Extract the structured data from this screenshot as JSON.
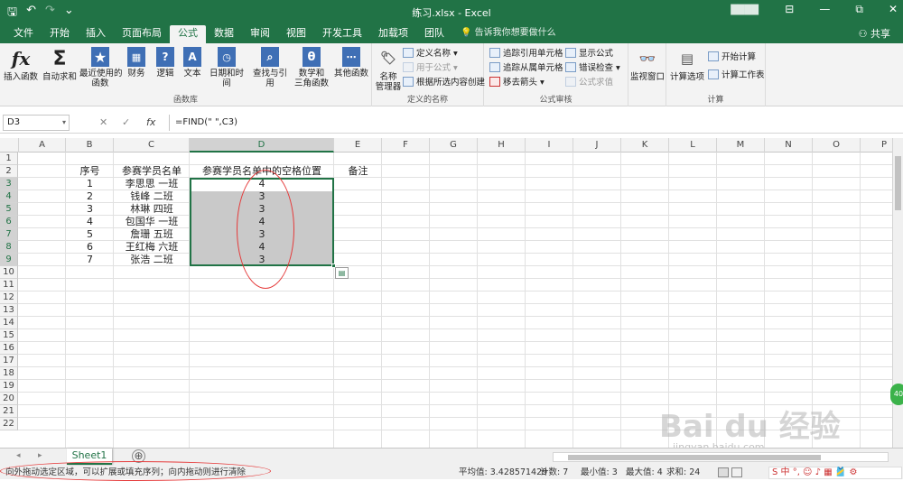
{
  "window": {
    "title": "练习.xlsx  -  Excel",
    "user": "████",
    "min": "—",
    "restore": "⧉",
    "close": "✕",
    "ribbon_opts": "⊟"
  },
  "qat": {
    "save": "🖫",
    "undo": "↶",
    "redo": "↷",
    "custom": "⌄"
  },
  "tabs": [
    "文件",
    "开始",
    "插入",
    "页面布局",
    "公式",
    "数据",
    "审阅",
    "视图",
    "开发工具",
    "加载项",
    "团队"
  ],
  "tell_me": "告诉我你想要做什么",
  "share": "共享",
  "ribbon": {
    "groups": {
      "library": "函数库",
      "names": "定义的名称",
      "audit": "公式审核",
      "calc": "计算"
    },
    "insert_function": "插入函数",
    "autosum": "自动求和",
    "recent": "最近使用的\n函数",
    "financial": "财务",
    "logical": "逻辑",
    "text": "文本",
    "datetime": "日期和时间",
    "lookup": "查找与引用",
    "math": "数学和\n三角函数",
    "other": "其他函数",
    "name_manager": "名称\n管理器",
    "define_name": "定义名称",
    "use_in_formula": "用于公式",
    "create_from_selection": "根据所选内容创建",
    "trace_precedents": "追踪引用单元格",
    "trace_dependents": "追踪从属单元格",
    "remove_arrows": "移去箭头",
    "show_formulas": "显示公式",
    "error_checking": "错误检查",
    "evaluate": "公式求值",
    "watch": "监视窗口",
    "calc_options": "计算选项",
    "calc_now": "开始计算",
    "calc_sheet": "计算工作表"
  },
  "formula_bar": {
    "name_box": "D3",
    "fx": "fx",
    "cancel": "✕",
    "enter": "✓",
    "formula": "=FIND(\" \",C3)"
  },
  "columns": [
    "A",
    "B",
    "C",
    "D",
    "E",
    "F",
    "G",
    "H",
    "I",
    "J",
    "K",
    "L",
    "M",
    "N",
    "O",
    "P"
  ],
  "rows": [
    "1",
    "2",
    "3",
    "4",
    "5",
    "6",
    "7",
    "8",
    "9",
    "10",
    "11",
    "12",
    "13",
    "14",
    "15",
    "16",
    "17",
    "18",
    "19",
    "20",
    "21",
    "22"
  ],
  "sheet": {
    "headers": {
      "b": "序号",
      "c": "参赛学员名单",
      "d": "参赛学员名单中的空格位置",
      "e": "备注"
    },
    "data": [
      {
        "no": "1",
        "name": "李思思 一班",
        "pos": "4"
      },
      {
        "no": "2",
        "name": "钱峰 二班",
        "pos": "3"
      },
      {
        "no": "3",
        "name": "林琳 四班",
        "pos": "3"
      },
      {
        "no": "4",
        "name": "包国华 一班",
        "pos": "4"
      },
      {
        "no": "5",
        "name": "詹珊 五班",
        "pos": "3"
      },
      {
        "no": "6",
        "name": "王红梅 六班",
        "pos": "4"
      },
      {
        "no": "7",
        "name": "张浩 二班",
        "pos": "3"
      }
    ]
  },
  "sheet_tab": "Sheet1",
  "add_sheet": "⊕",
  "status": {
    "message": "向外拖动选定区域，可以扩展或填充序列；向内拖动则进行清除",
    "average": "平均值: 3.428571429",
    "count": "计数: 7",
    "min": "最小值: 3",
    "max": "最大值: 4",
    "sum": "求和: 24",
    "sogou": "S 中 °, ☺ ♪ ▦ 🎽 ⚙"
  },
  "watermark": "Bai du 经验",
  "watermark_url": "jingyan.baidu.com",
  "badge": "40"
}
